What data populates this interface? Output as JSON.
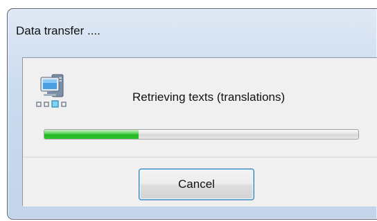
{
  "window": {
    "title": "Data transfer ...."
  },
  "status": {
    "message": "Retrieving texts (translations)",
    "progress_fraction": 0.3,
    "progress_color": "#2fc52d"
  },
  "icons": {
    "main": "computer-network-icon"
  },
  "buttons": {
    "cancel_label": "Cancel"
  }
}
